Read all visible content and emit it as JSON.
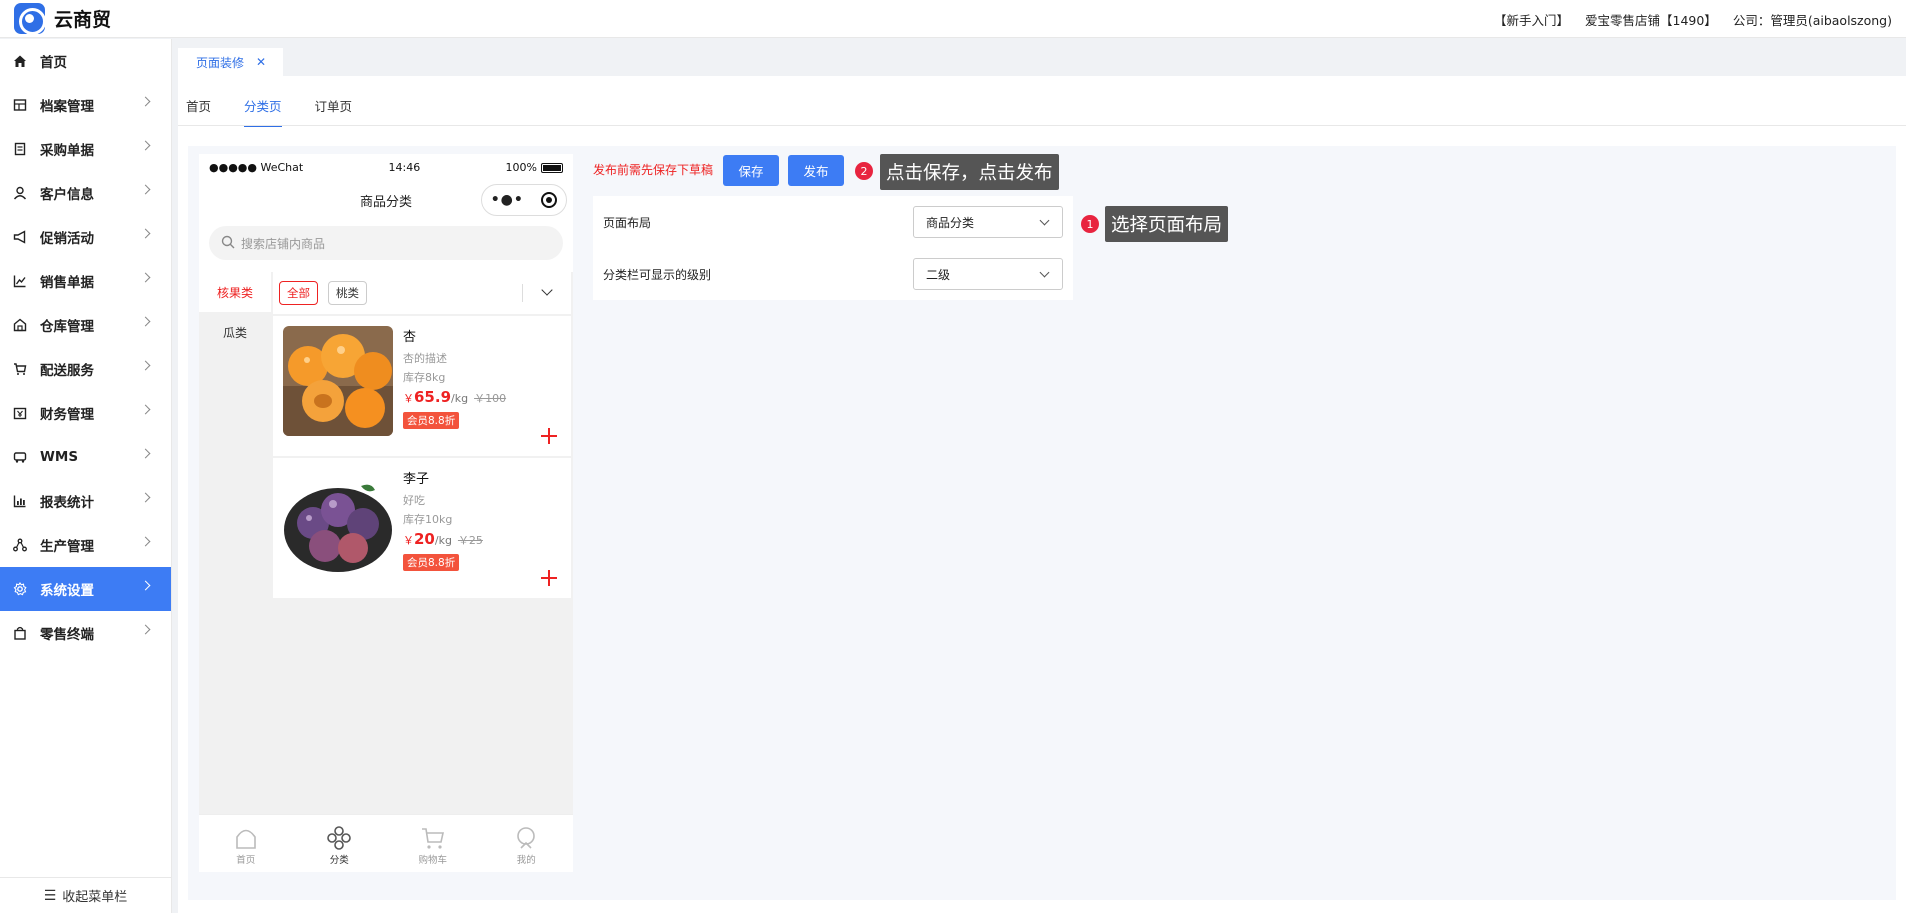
{
  "app": {
    "name": "云商贸"
  },
  "topbar": {
    "guide": "【新手入门】",
    "store": "爱宝零售店铺【1490】",
    "company": "公司：管理员(aibaolszong)"
  },
  "sidebar": {
    "items": [
      {
        "label": "首页",
        "icon": "home-icon"
      },
      {
        "label": "档案管理",
        "icon": "archive-icon"
      },
      {
        "label": "采购单据",
        "icon": "document-icon"
      },
      {
        "label": "客户信息",
        "icon": "user-icon"
      },
      {
        "label": "促销活动",
        "icon": "megaphone-icon"
      },
      {
        "label": "销售单据",
        "icon": "trend-chart-icon"
      },
      {
        "label": "仓库管理",
        "icon": "warehouse-icon"
      },
      {
        "label": "配送服务",
        "icon": "cart-icon"
      },
      {
        "label": "财务管理",
        "icon": "finance-icon"
      },
      {
        "label": "WMS",
        "icon": "truck-icon"
      },
      {
        "label": "报表统计",
        "icon": "bar-chart-icon"
      },
      {
        "label": "生产管理",
        "icon": "network-icon"
      },
      {
        "label": "系统设置",
        "icon": "gear-icon",
        "active": true
      },
      {
        "label": "零售终端",
        "icon": "bag-icon"
      }
    ],
    "collapse_label": "收起菜单栏"
  },
  "page_tab": {
    "label": "页面装修",
    "close": "✕"
  },
  "subtabs": [
    {
      "label": "首页"
    },
    {
      "label": "分类页",
      "active": true
    },
    {
      "label": "订单页"
    }
  ],
  "phone": {
    "status_left": "●●●●● WeChat",
    "status_time": "14:46",
    "status_battery": "100%",
    "title": "商品分类",
    "capsule_dots": "•●•",
    "search_placeholder": "搜索店铺内商品",
    "categories": [
      {
        "label": "核果类",
        "active": true
      },
      {
        "label": "瓜类"
      }
    ],
    "chips": [
      {
        "label": "全部",
        "active": true
      },
      {
        "label": "桃类"
      }
    ],
    "goods": [
      {
        "name": "杏",
        "desc": "杏的描述",
        "stock": "库存8kg",
        "currency": "￥",
        "price": "65.9",
        "unit": "/kg",
        "orig": "￥100",
        "badge": "会员8.8折"
      },
      {
        "name": "李子",
        "desc": "好吃",
        "stock": "库存10kg",
        "currency": "￥",
        "price": "20",
        "unit": "/kg",
        "orig": "￥25",
        "badge": "会员8.8折"
      }
    ],
    "tabbar": [
      {
        "label": "首页"
      },
      {
        "label": "分类",
        "active": true
      },
      {
        "label": "购物车"
      },
      {
        "label": "我的"
      }
    ]
  },
  "config": {
    "hint": "发布前需先保存下草稿",
    "save_label": "保存",
    "publish_label": "发布",
    "layout_label": "页面布局",
    "layout_value": "商品分类",
    "level_label": "分类栏可显示的级别",
    "level_value": "二级"
  },
  "callouts": {
    "step1_num": "1",
    "step1_text": "选择页面布局",
    "step2_num": "2",
    "step2_text": "点击保存，点击发布"
  },
  "colors": {
    "accent": "#3d7cf4",
    "price_red": "#e22",
    "callout_bg": "#555555",
    "badge_red": "#e8243f"
  }
}
